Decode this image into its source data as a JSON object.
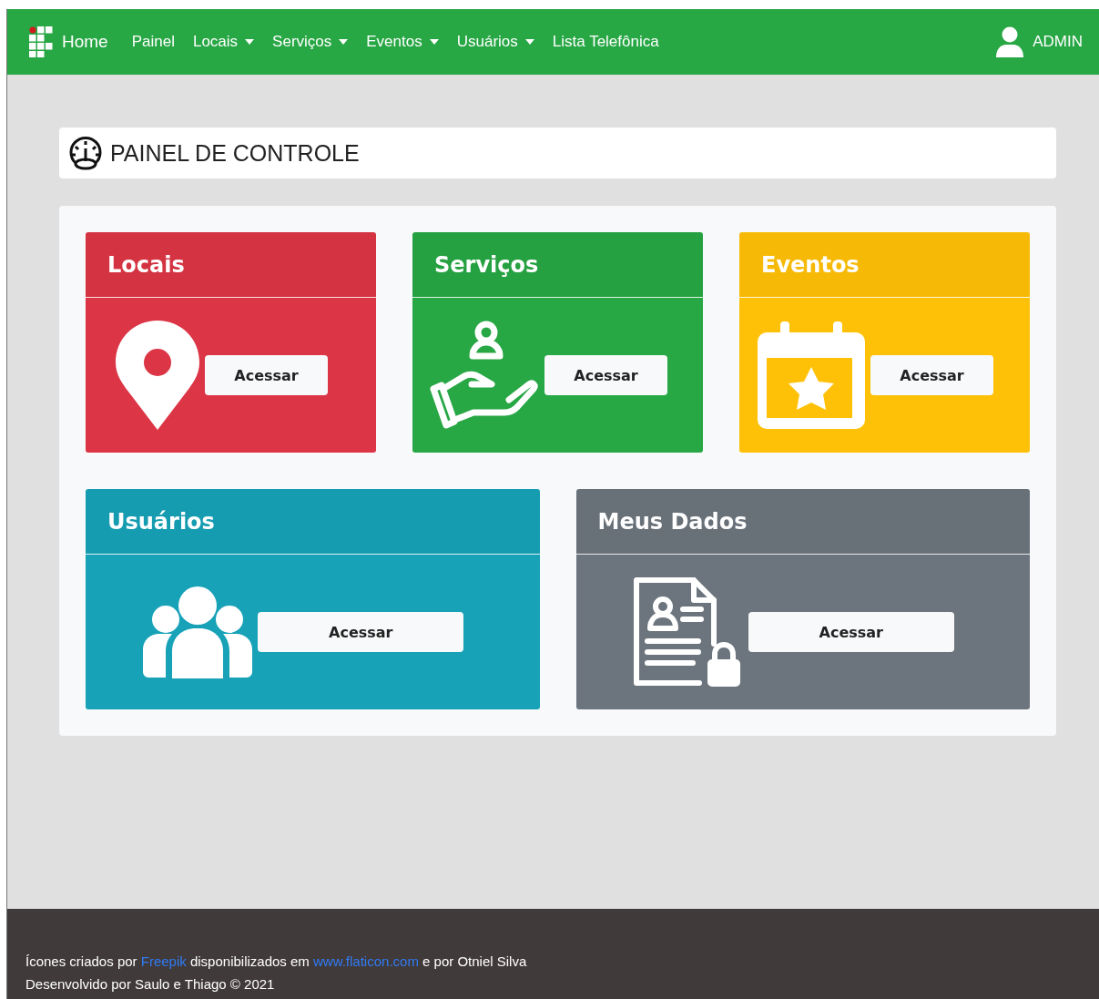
{
  "navbar": {
    "brand": "Home",
    "items": [
      {
        "label": "Painel",
        "dropdown": false
      },
      {
        "label": "Locais",
        "dropdown": true
      },
      {
        "label": "Serviços",
        "dropdown": true
      },
      {
        "label": "Eventos",
        "dropdown": true
      },
      {
        "label": "Usuários",
        "dropdown": true
      },
      {
        "label": "Lista Telefônica",
        "dropdown": false
      }
    ],
    "user": "ADMIN"
  },
  "header": {
    "title": "PAINEL DE CONTROLE"
  },
  "cards": [
    {
      "title": "Locais",
      "kind": "location",
      "color": "#dc3545",
      "button": "Acessar"
    },
    {
      "title": "Serviços",
      "kind": "service",
      "color": "#28a745",
      "button": "Acessar"
    },
    {
      "title": "Eventos",
      "kind": "event",
      "color": "#ffc107",
      "button": "Acessar"
    },
    {
      "title": "Usuários",
      "kind": "users",
      "color": "#17a2b8",
      "button": "Acessar"
    },
    {
      "title": "Meus Dados",
      "kind": "data",
      "color": "#6c757d",
      "button": "Acessar"
    }
  ],
  "footer": {
    "credits": [
      {
        "kind": "text",
        "text": "Ícones criados por "
      },
      {
        "kind": "link",
        "text": "Freepik"
      },
      {
        "kind": "text",
        "text": " disponibilizados em "
      },
      {
        "kind": "link",
        "text": "www.flaticon.com"
      },
      {
        "kind": "text",
        "text": " e por Otniel Silva"
      }
    ],
    "copyright": "Desenvolvido por Saulo e Thiago © 2021"
  }
}
